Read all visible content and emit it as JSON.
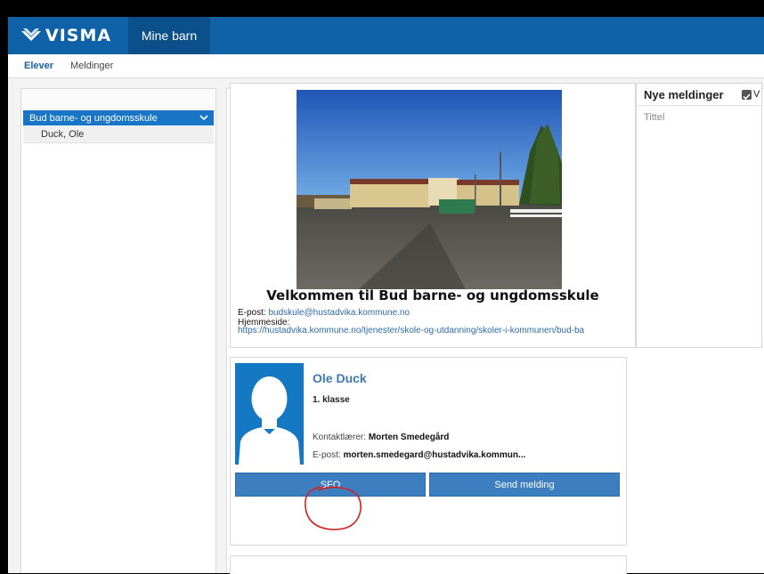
{
  "topbar": {
    "logo_text": "VISMA",
    "active_tab": "Mine barn"
  },
  "subnav": {
    "elever": "Elever",
    "meldinger": "Meldinger"
  },
  "sidebar": {
    "school": "Bud barne- og ungdomsskule",
    "student": "Duck, Ole"
  },
  "welcome": {
    "title": "Velkommen til Bud barne- og ungdomsskule",
    "email_label": "E-post:",
    "email": "budskule@hustadvika.kommune.no",
    "homepage_label": "Hjemmeside:",
    "homepage_url": "https://hustadvika.kommune.no/tjenester/skole-og-utdanning/skoler-i-kommunen/bud-ba"
  },
  "messages": {
    "title": "Nye meldinger",
    "checkbox_label": "V",
    "column_title": "Tittel"
  },
  "student": {
    "name": "Ole Duck",
    "class": "1. klasse",
    "contact_label": "Kontaktlærer:",
    "contact_name": "Morten Smedegård",
    "email_label": "E-post:",
    "email": "morten.smedegard@hustadvika.kommun...",
    "sfo_button": "SFO",
    "send_button": "Send melding"
  },
  "colors": {
    "brand": "#0f62a8",
    "button": "#3d7ec0",
    "link": "#2f6aa8",
    "annotation": "#d62020"
  }
}
